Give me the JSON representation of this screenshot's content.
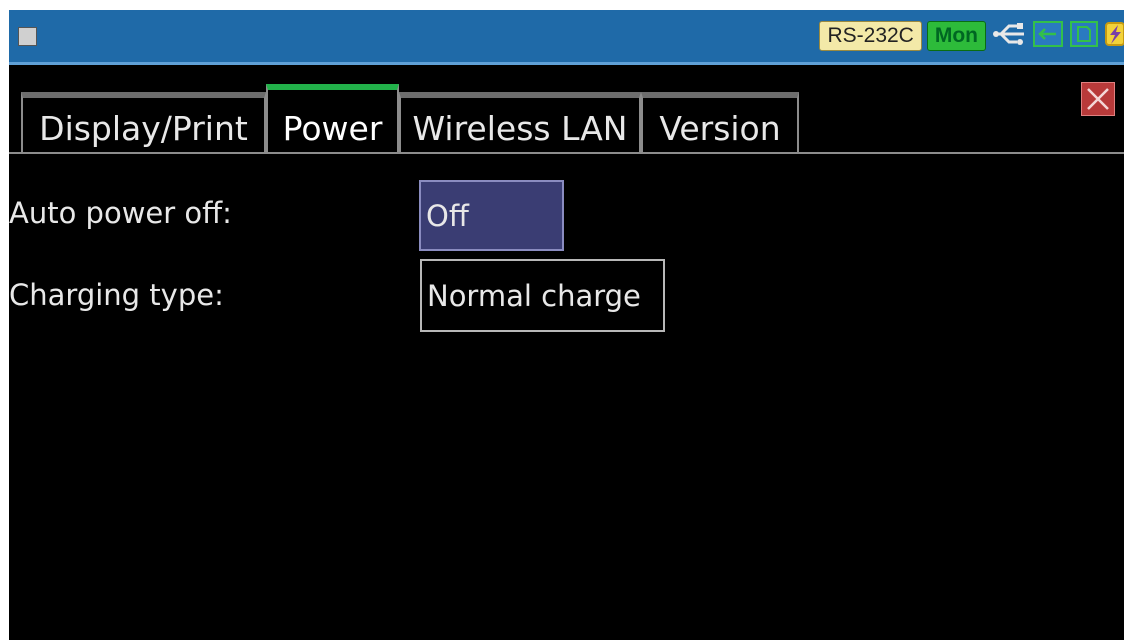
{
  "status_bar": {
    "menu_icon": "square-icon",
    "interface_label": "RS-232C",
    "mode_label": "Mon",
    "icons": [
      "usb-icon",
      "connection-icon",
      "card-icon",
      "battery-charging-icon"
    ],
    "colors": {
      "bar": "#1f6aa8",
      "interface_badge": "#f3e9a8",
      "mode_badge": "#2dbb3a"
    }
  },
  "tabs": [
    {
      "label": "Display/Print",
      "active": false
    },
    {
      "label": "Power",
      "active": true
    },
    {
      "label": "Wireless LAN",
      "active": false
    },
    {
      "label": "Version",
      "active": false
    }
  ],
  "close_icon": "close-icon",
  "settings": {
    "auto_power_off": {
      "label": "Auto power off:",
      "value": "Off"
    },
    "charging_type": {
      "label": "Charging type:",
      "value": "Normal charge"
    }
  },
  "colors": {
    "background": "#000000",
    "active_tab_accent": "#22b24a",
    "selected_field": "#3a3d73",
    "close_button": "#b83a3a"
  }
}
